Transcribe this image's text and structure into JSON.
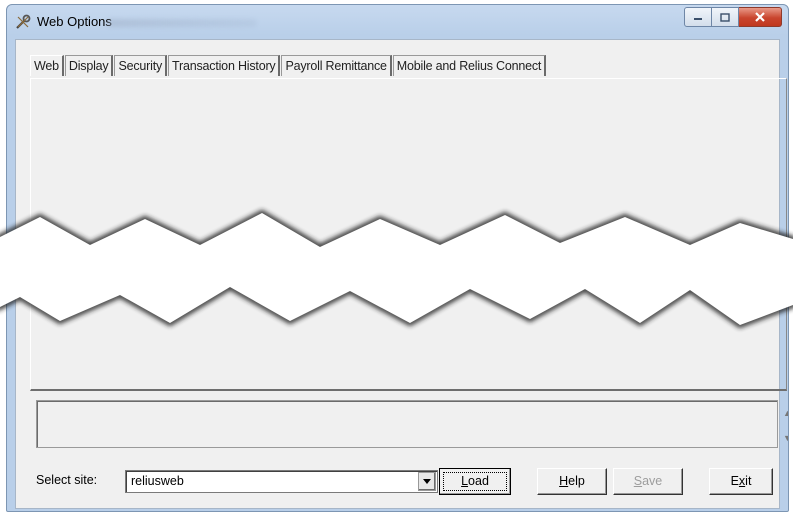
{
  "window": {
    "title": "Web Options",
    "icon": "wrench-icon",
    "controls": [
      "minimize-icon",
      "maximize-icon",
      "close-icon"
    ]
  },
  "tabs": [
    {
      "label": "Web",
      "active": true
    },
    {
      "label": "Display",
      "active": false
    },
    {
      "label": "Security",
      "active": false
    },
    {
      "label": "Transaction History",
      "active": false
    },
    {
      "label": "Payroll Remittance",
      "active": false
    },
    {
      "label": "Mobile and Relius Connect",
      "active": false
    }
  ],
  "site": {
    "label": "Select site:",
    "value": "reliusweb"
  },
  "buttons": {
    "load": {
      "pre": "",
      "key": "L",
      "post": "oad"
    },
    "help": {
      "pre": "",
      "key": "H",
      "post": "elp"
    },
    "save": {
      "pre": "",
      "key": "S",
      "post": "ave",
      "disabled": true
    },
    "exit": {
      "pre": "E",
      "key": "x",
      "post": "it"
    }
  },
  "colors": {
    "close_button": "#c9452e",
    "frame": "#b9cfe9",
    "client": "#f0f0f0"
  }
}
